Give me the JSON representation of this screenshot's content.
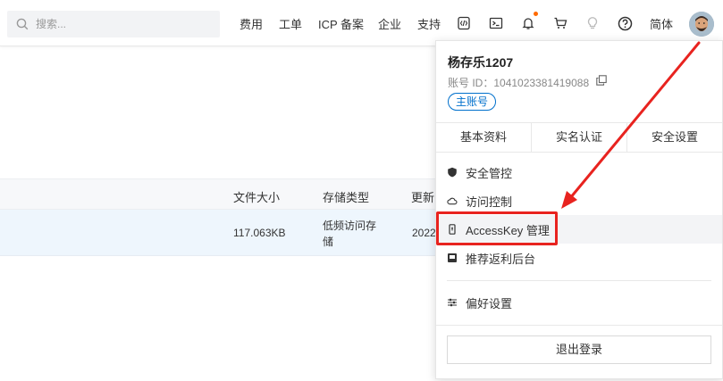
{
  "search": {
    "placeholder": "搜索..."
  },
  "nav": {
    "items": [
      "费用",
      "工单",
      "ICP 备案",
      "企业",
      "支持"
    ],
    "language": "简体"
  },
  "icons": {
    "search": "search-icon",
    "devtools": "developer-tools-icon",
    "terminal": "terminal-icon",
    "bell": "bell-icon",
    "cart": "cart-icon",
    "bulb": "lightbulb-icon",
    "help": "help-icon"
  },
  "colors": {
    "accent": "#0070cc",
    "notice": "#ff6a00",
    "annotation": "#e8231f",
    "row_highlight": "#eef6fd"
  },
  "table": {
    "headers": {
      "size": "文件大小",
      "storage": "存储类型",
      "updated": "更新时"
    },
    "row": {
      "size": "117.063KB",
      "storage_line1": "低频访问存",
      "storage_line2": "储",
      "updated": "2022"
    }
  },
  "user_menu": {
    "name": "杨存乐1207",
    "account_label": "账号 ID：",
    "account_id": "1041023381419088",
    "badge": "主账号",
    "tabs": [
      "基本资料",
      "实名认证",
      "安全设置"
    ],
    "items": [
      {
        "label": "安全管控",
        "icon": "shield-icon"
      },
      {
        "label": "访问控制",
        "icon": "cloud-icon"
      },
      {
        "label": "AccessKey 管理",
        "icon": "key-icon",
        "highlighted": true
      },
      {
        "label": "推荐返利后台",
        "icon": "rebate-icon"
      },
      {
        "label": "偏好设置",
        "icon": "sliders-icon"
      }
    ],
    "logout": "退出登录"
  }
}
